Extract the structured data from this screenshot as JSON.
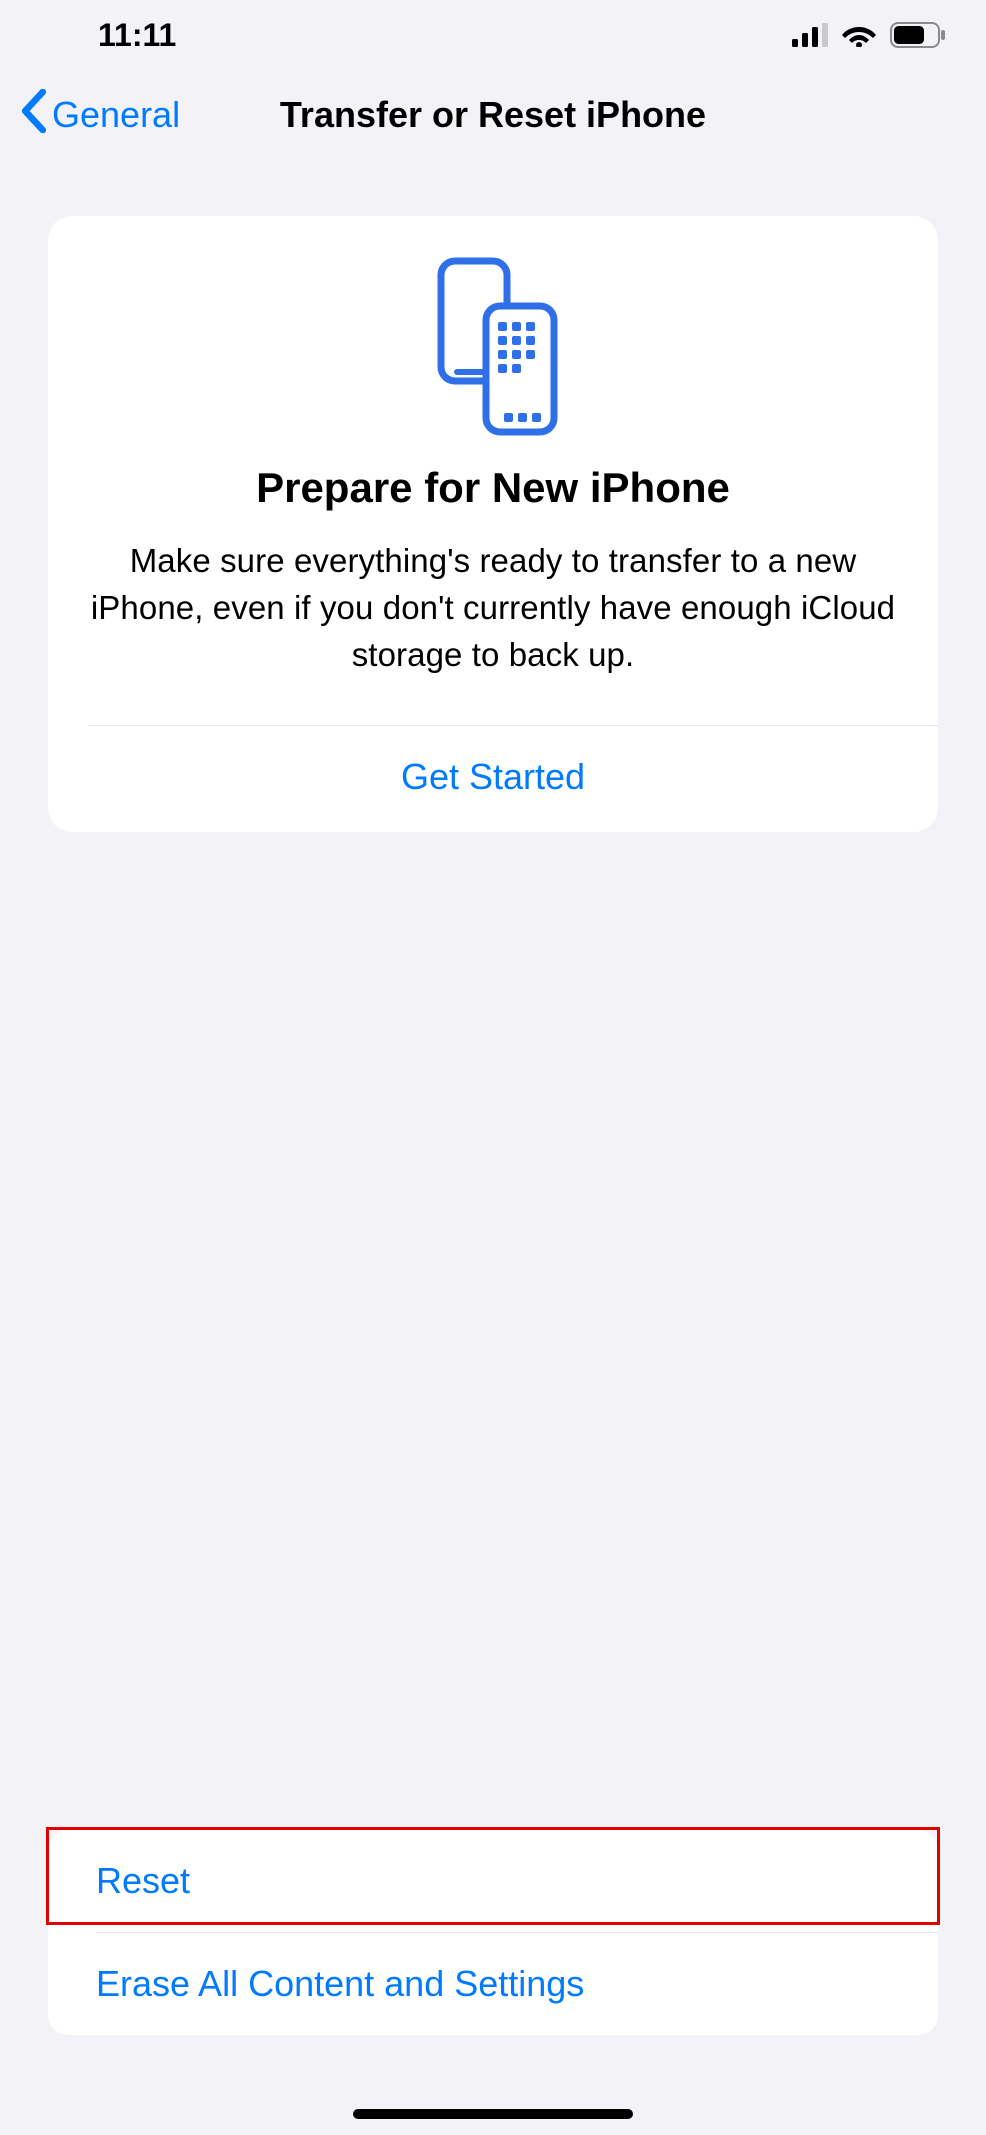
{
  "status": {
    "time": "11:11"
  },
  "nav": {
    "back_label": "General",
    "title": "Transfer or Reset iPhone"
  },
  "prepare": {
    "title": "Prepare for New iPhone",
    "description": "Make sure everything's ready to transfer to a new iPhone, even if you don't currently have enough iCloud storage to back up.",
    "action_label": "Get Started"
  },
  "options": {
    "reset_label": "Reset",
    "erase_label": "Erase All Content and Settings"
  }
}
